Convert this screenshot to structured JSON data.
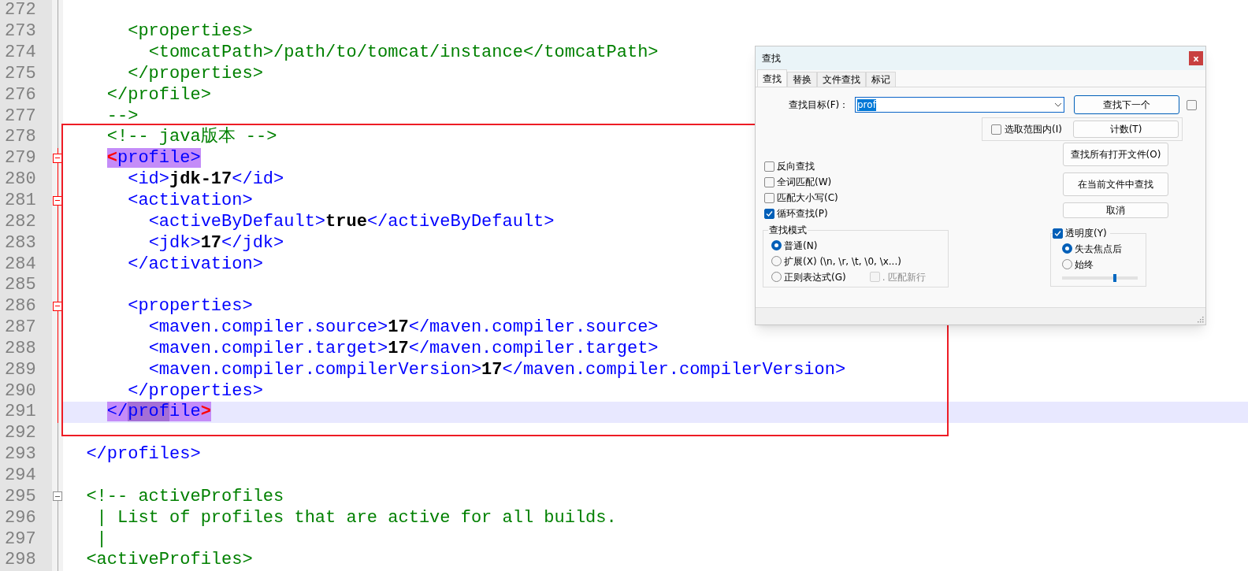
{
  "editor": {
    "lines": [
      {
        "number": "272",
        "fold_box": false,
        "block_highlight": false
      },
      {
        "number": "273",
        "fold_box": false,
        "block_highlight": false,
        "current": false,
        "segments": [
          {
            "kind": "comment",
            "text": "      <properties>"
          }
        ]
      },
      {
        "number": "274",
        "fold_box": false,
        "block_highlight": false,
        "current": false,
        "segments": [
          {
            "kind": "comment",
            "text": "        <tomcatPath>/path/to/tomcat/instance</tomcatPath>"
          }
        ]
      },
      {
        "number": "275",
        "fold_box": false,
        "block_highlight": false,
        "current": false,
        "segments": [
          {
            "kind": "comment",
            "text": "      </properties>"
          }
        ]
      },
      {
        "number": "276",
        "fold_box": false,
        "block_highlight": false,
        "current": false,
        "segments": [
          {
            "kind": "comment",
            "text": "    </profile>"
          }
        ]
      },
      {
        "number": "277",
        "fold_box": false,
        "block_highlight": false,
        "current": false,
        "segments": [
          {
            "kind": "comment",
            "text": "    -->"
          }
        ]
      },
      {
        "number": "278",
        "fold_box": false,
        "block_highlight": false,
        "current": false,
        "segments": [
          {
            "kind": "comment",
            "text": "    <!-- java版本 -->"
          }
        ]
      },
      {
        "number": "279",
        "fold_box": true,
        "block_highlight": true,
        "current": false,
        "segments": [
          {
            "kind": "brace",
            "text": "    <",
            "match": true,
            "found": false
          },
          {
            "kind": "tag",
            "text": "profile>",
            "match": true,
            "found": false
          }
        ]
      },
      {
        "number": "280",
        "fold_box": false,
        "block_highlight": true,
        "current": false,
        "segments": [
          {
            "kind": "tag",
            "text": "      <id>"
          },
          {
            "kind": "value",
            "text": "jdk-17"
          },
          {
            "kind": "tag",
            "text": "</id>"
          }
        ]
      },
      {
        "number": "281",
        "fold_box": true,
        "block_highlight": true,
        "current": false,
        "segments": [
          {
            "kind": "tag",
            "text": "      <activation>"
          }
        ]
      },
      {
        "number": "282",
        "fold_box": false,
        "block_highlight": true,
        "current": false,
        "segments": [
          {
            "kind": "tag",
            "text": "        <activeByDefault>"
          },
          {
            "kind": "value",
            "text": "true"
          },
          {
            "kind": "tag",
            "text": "</activeByDefault>"
          }
        ]
      },
      {
        "number": "283",
        "fold_box": false,
        "block_highlight": true,
        "current": false,
        "segments": [
          {
            "kind": "tag",
            "text": "        <jdk>"
          },
          {
            "kind": "value",
            "text": "17"
          },
          {
            "kind": "tag",
            "text": "</jdk>"
          }
        ]
      },
      {
        "number": "284",
        "fold_box": false,
        "block_highlight": true,
        "current": false,
        "segments": [
          {
            "kind": "tag",
            "text": "      </activation>"
          }
        ]
      },
      {
        "number": "285",
        "fold_box": false,
        "block_highlight": true
      },
      {
        "number": "286",
        "fold_box": true,
        "block_highlight": true,
        "current": false,
        "segments": [
          {
            "kind": "tag",
            "text": "      <properties>"
          }
        ]
      },
      {
        "number": "287",
        "fold_box": false,
        "block_highlight": true,
        "current": false,
        "segments": [
          {
            "kind": "tag",
            "text": "        <maven.compiler.source>"
          },
          {
            "kind": "value",
            "text": "17"
          },
          {
            "kind": "tag",
            "text": "</maven.compiler.source>"
          }
        ]
      },
      {
        "number": "288",
        "fold_box": false,
        "block_highlight": true,
        "current": false,
        "segments": [
          {
            "kind": "tag",
            "text": "        <maven.compiler.target>"
          },
          {
            "kind": "value",
            "text": "17"
          },
          {
            "kind": "tag",
            "text": "</maven.compiler.target>"
          }
        ]
      },
      {
        "number": "289",
        "fold_box": false,
        "block_highlight": true,
        "current": false,
        "segments": [
          {
            "kind": "tag",
            "text": "        <maven.compiler.compilerVersion>"
          },
          {
            "kind": "value",
            "text": "17"
          },
          {
            "kind": "tag",
            "text": "</maven.compiler.compilerVersion>"
          }
        ]
      },
      {
        "number": "290",
        "fold_box": false,
        "block_highlight": true,
        "current": false,
        "segments": [
          {
            "kind": "tag",
            "text": "      </properties>"
          }
        ]
      },
      {
        "number": "291",
        "fold_box": false,
        "block_highlight": true,
        "current": true,
        "segments": [
          {
            "kind": "tag",
            "text": "    </",
            "match": true,
            "found": false
          },
          {
            "kind": "tag",
            "text": "prof",
            "match": true,
            "found": true
          },
          {
            "kind": "tag",
            "text": "ile",
            "match": true,
            "found": false
          },
          {
            "kind": "brace",
            "text": ">",
            "match": true,
            "found": false
          }
        ]
      },
      {
        "number": "292",
        "fold_box": false,
        "block_highlight": false
      },
      {
        "number": "293",
        "fold_box": false,
        "block_highlight": false,
        "current": false,
        "segments": [
          {
            "kind": "tag",
            "text": "  </profiles>"
          }
        ]
      },
      {
        "number": "294",
        "fold_box": false,
        "block_highlight": false
      },
      {
        "number": "295",
        "fold_box": true,
        "block_highlight": false,
        "current": false,
        "segments": [
          {
            "kind": "comment",
            "text": "  <!-- activeProfiles"
          }
        ]
      },
      {
        "number": "296",
        "fold_box": false,
        "block_highlight": false,
        "current": false,
        "segments": [
          {
            "kind": "comment",
            "text": "   | List of profiles that are active for all builds."
          }
        ]
      },
      {
        "number": "297",
        "fold_box": false,
        "block_highlight": false,
        "current": false,
        "segments": [
          {
            "kind": "comment",
            "text": "   |"
          }
        ]
      },
      {
        "number": "298",
        "fold_box": false,
        "block_highlight": false,
        "current": false,
        "segments": [
          {
            "kind": "comment",
            "text": "  <activeProfiles>"
          }
        ]
      }
    ]
  },
  "find_dialog": {
    "title": "查找",
    "close": "x",
    "tabs": [
      {
        "label": "查找",
        "selected": true
      },
      {
        "label": "替换",
        "selected": false
      },
      {
        "label": "文件查找",
        "selected": false
      },
      {
        "label": "标记",
        "selected": false
      }
    ],
    "target": {
      "label": "查找目标(F)：",
      "value": "prof"
    },
    "find_next_button": "查找下一个",
    "find_next_option": {
      "checked": false
    },
    "in_selection": {
      "label": "选取范围内(I)",
      "checked": false
    },
    "count_button": "计数(T)",
    "find_all_open_button": "查找所有打开文件(O)",
    "find_in_current_button": "在当前文件中查找",
    "cancel_button": "取消",
    "options": [
      {
        "label": "反向查找",
        "checked": false
      },
      {
        "label": "全词匹配(W)",
        "checked": false
      },
      {
        "label": "匹配大小写(C)",
        "checked": false
      },
      {
        "label": "循环查找(P)",
        "checked": true
      }
    ],
    "mode": {
      "title": "查找模式",
      "options": [
        {
          "label": "普通(N)",
          "selected": true
        },
        {
          "label": "扩展(X) (\\n, \\r, \\t, \\0, \\x...)",
          "selected": false
        },
        {
          "label": "正则表达式(G)",
          "selected": false
        }
      ],
      "dot_newline": {
        "label": ". 匹配新行",
        "checked": false,
        "disabled": true
      }
    },
    "transparency": {
      "label": "透明度(Y)",
      "checked": true,
      "options": [
        {
          "label": "失去焦点后",
          "selected": true
        },
        {
          "label": "始终",
          "selected": false
        }
      ],
      "level": 0.7
    }
  }
}
